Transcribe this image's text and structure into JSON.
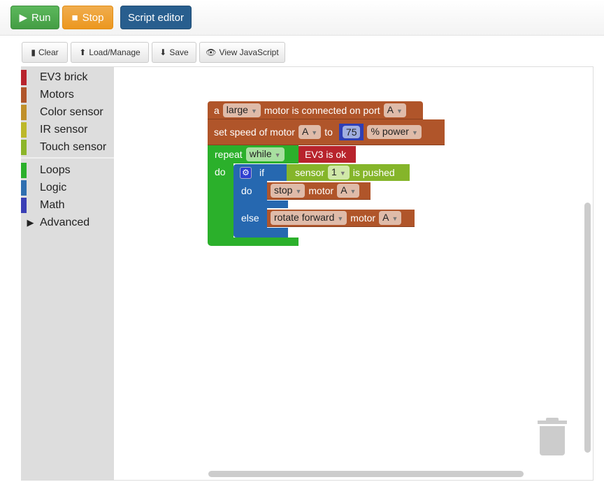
{
  "topbar": {
    "run": "Run",
    "stop": "Stop",
    "script_editor": "Script editor"
  },
  "toolbar": {
    "clear": "Clear",
    "load": "Load/Manage",
    "save": "Save",
    "view_js": "View JavaScript"
  },
  "categories": [
    {
      "label": "EV3 brick",
      "color": "#b8232c"
    },
    {
      "label": "Motors",
      "color": "#b0552a"
    },
    {
      "label": "Color sensor",
      "color": "#c0902a"
    },
    {
      "label": "IR sensor",
      "color": "#bdb82a"
    },
    {
      "label": "Touch sensor",
      "color": "#8cb52a"
    },
    {
      "label": "Loops",
      "color": "#2bb02b"
    },
    {
      "label": "Logic",
      "color": "#2f6fb0"
    },
    {
      "label": "Math",
      "color": "#3a3fb5"
    },
    {
      "label": "Advanced",
      "color": ""
    }
  ],
  "blocks": {
    "b1": {
      "a": "a",
      "size": "large",
      "text": "motor is connected on port",
      "port": "A"
    },
    "b2": {
      "text": "set speed of motor",
      "port": "A",
      "to": "to",
      "value": "75",
      "unit": "% power"
    },
    "repeat": {
      "label": "repeat",
      "mode": "while",
      "do": "do",
      "cond": "EV3 is ok"
    },
    "ifb": {
      "if": "if",
      "do": "do",
      "else": "else",
      "sensor": "sensor",
      "num": "1",
      "pushed": "is pushed"
    },
    "stop": {
      "action": "stop",
      "motor": "motor",
      "port": "A"
    },
    "rotate": {
      "action": "rotate forward",
      "motor": "motor",
      "port": "A"
    }
  }
}
